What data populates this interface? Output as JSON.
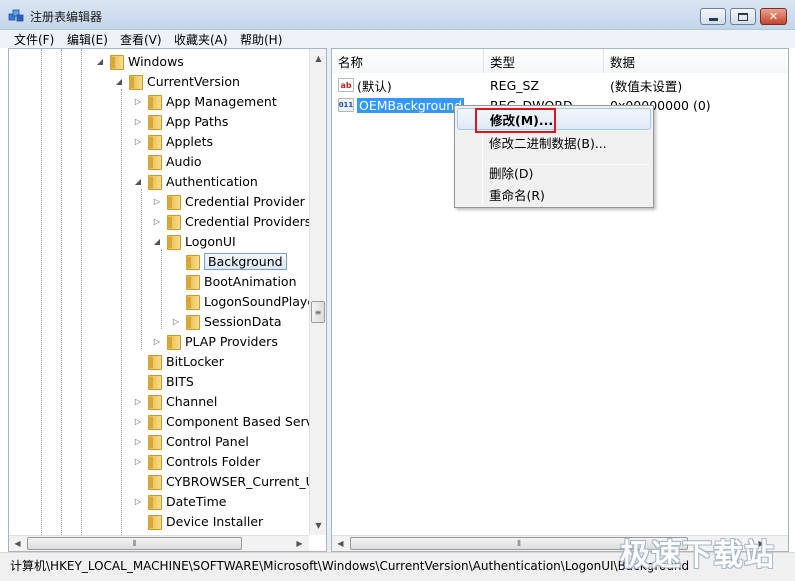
{
  "window": {
    "title": "注册表编辑器",
    "icon": "regedit-icon"
  },
  "menu": [
    "文件(F)",
    "编辑(E)",
    "查看(V)",
    "收藏夹(A)",
    "帮助(H)"
  ],
  "tree": {
    "items": [
      {
        "label": "Windows",
        "expander": "◢",
        "selected": false
      },
      {
        "label": "CurrentVersion",
        "expander": "◢",
        "selected": false
      },
      {
        "label": "App Management",
        "expander": "▷",
        "selected": false
      },
      {
        "label": "App Paths",
        "expander": "▷",
        "selected": false
      },
      {
        "label": "Applets",
        "expander": "▷",
        "selected": false
      },
      {
        "label": "Audio",
        "expander": "",
        "selected": false
      },
      {
        "label": "Authentication",
        "expander": "◢",
        "selected": false
      },
      {
        "label": "Credential Provider F",
        "expander": "▷",
        "selected": false
      },
      {
        "label": "Credential Providers",
        "expander": "▷",
        "selected": false
      },
      {
        "label": "LogonUI",
        "expander": "◢",
        "selected": false
      },
      {
        "label": "Background",
        "expander": "",
        "selected": true
      },
      {
        "label": "BootAnimation",
        "expander": "",
        "selected": false
      },
      {
        "label": "LogonSoundPlaye",
        "expander": "",
        "selected": false
      },
      {
        "label": "SessionData",
        "expander": "▷",
        "selected": false
      },
      {
        "label": "PLAP Providers",
        "expander": "▷",
        "selected": false
      },
      {
        "label": "BitLocker",
        "expander": "",
        "selected": false
      },
      {
        "label": "BITS",
        "expander": "",
        "selected": false
      },
      {
        "label": "Channel",
        "expander": "▷",
        "selected": false
      },
      {
        "label": "Component Based Servi",
        "expander": "▷",
        "selected": false
      },
      {
        "label": "Control Panel",
        "expander": "▷",
        "selected": false
      },
      {
        "label": "Controls Folder",
        "expander": "▷",
        "selected": false
      },
      {
        "label": "CYBROWSER_Current_Up",
        "expander": "",
        "selected": false
      },
      {
        "label": "DateTime",
        "expander": "▷",
        "selected": false
      },
      {
        "label": "Device Installer",
        "expander": "",
        "selected": false
      }
    ]
  },
  "list": {
    "columns": [
      "名称",
      "类型",
      "数据"
    ],
    "rows": [
      {
        "icon": "ab",
        "name": "(默认)",
        "type": "REG_SZ",
        "data": "(数值未设置)",
        "selected": false
      },
      {
        "icon": "011",
        "name": "OEMBackground",
        "type": "REG_DWORD",
        "data": "0x00000000 (0)",
        "selected": true
      }
    ]
  },
  "context_menu": {
    "items": [
      "修改(M)...",
      "修改二进制数据(B)...",
      "删除(D)",
      "重命名(R)"
    ]
  },
  "statusbar": {
    "path": "计算机\\HKEY_LOCAL_MACHINE\\SOFTWARE\\Microsoft\\Windows\\CurrentVersion\\Authentication\\LogonUI\\Background"
  },
  "watermark": "极速下载站",
  "colors": {
    "selection": "#3399ff",
    "highlight_box": "#e0141e"
  }
}
